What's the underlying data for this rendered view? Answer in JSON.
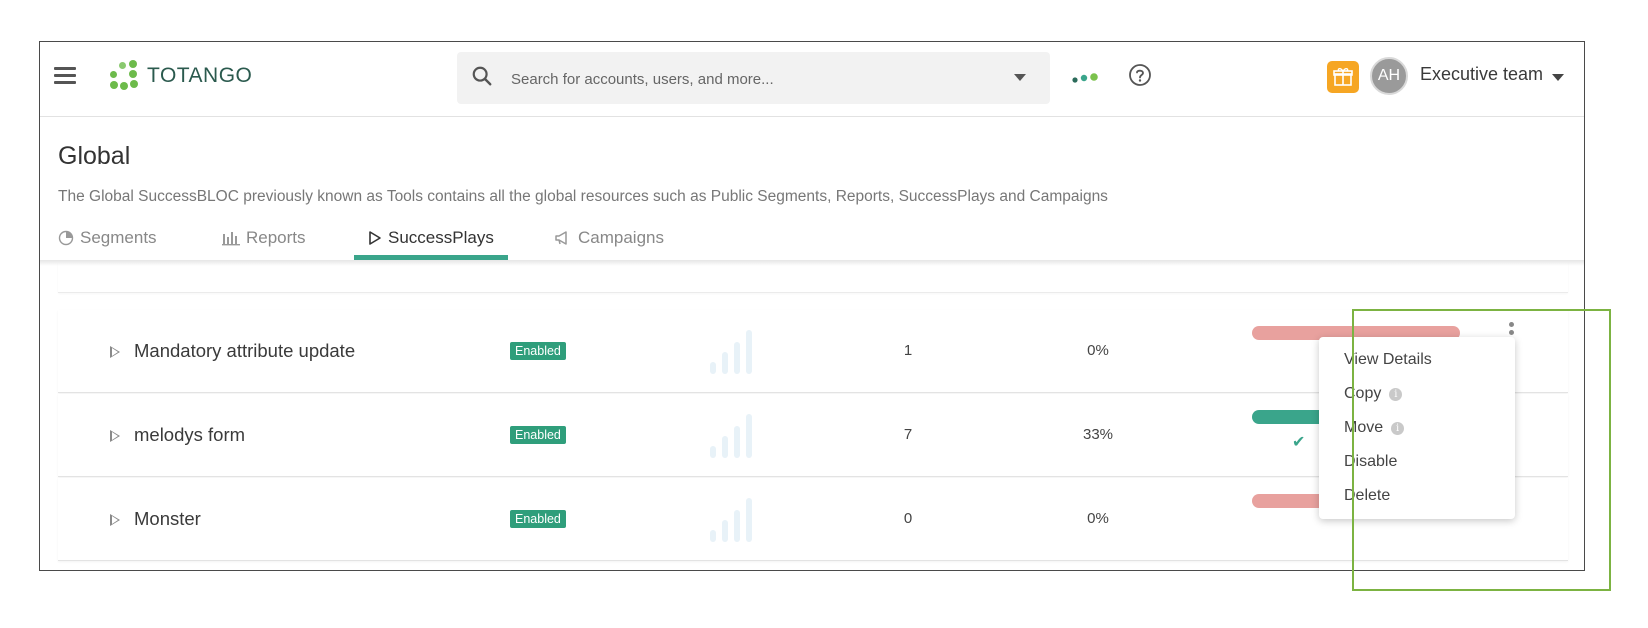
{
  "app": {
    "logo_text": "TOTANGO",
    "brand_color": "#3aa58b"
  },
  "search": {
    "placeholder": "Search for accounts, users, and more..."
  },
  "user": {
    "initials": "AH",
    "team_label": "Executive team"
  },
  "page": {
    "title": "Global",
    "description": "The Global SuccessBLOC previously known as Tools contains all the global resources such as Public Segments, Reports, SuccessPlays and Campaigns"
  },
  "tabs": [
    {
      "label": "Segments",
      "icon": "pie-chart-icon",
      "active": false
    },
    {
      "label": "Reports",
      "icon": "bar-chart-icon",
      "active": false
    },
    {
      "label": "SuccessPlays",
      "icon": "play-icon",
      "active": true
    },
    {
      "label": "Campaigns",
      "icon": "megaphone-icon",
      "active": false
    }
  ],
  "rows": [
    {
      "name": "Mandatory attribute update",
      "status": "Enabled",
      "count": "1",
      "percent": "0%",
      "bar_color": "#e8a19e"
    },
    {
      "name": "melodys form",
      "status": "Enabled",
      "count": "7",
      "percent": "33%",
      "bar_color": "#3aa58b"
    },
    {
      "name": "Monster",
      "status": "Enabled",
      "count": "0",
      "percent": "0%",
      "bar_color": "#e8a19e"
    }
  ],
  "menu": {
    "items": [
      "View Details",
      "Copy",
      "Move",
      "Disable",
      "Delete"
    ]
  },
  "colors": {
    "enabled_badge": "#2f9e7b",
    "highlight_box": "#7cb342",
    "gift": "#f6a623"
  }
}
